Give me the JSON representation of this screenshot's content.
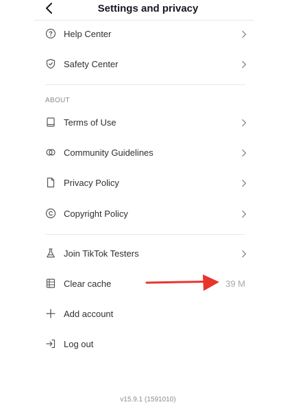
{
  "header": {
    "title": "Settings and privacy"
  },
  "support": {
    "items": [
      {
        "label": "Help Center",
        "icon": "question-circle-icon"
      },
      {
        "label": "Safety Center",
        "icon": "shield-check-icon"
      }
    ]
  },
  "about": {
    "section_label": "ABOUT",
    "items": [
      {
        "label": "Terms of Use",
        "icon": "book-icon"
      },
      {
        "label": "Community Guidelines",
        "icon": "interlocking-circles-icon"
      },
      {
        "label": "Privacy Policy",
        "icon": "document-icon"
      },
      {
        "label": "Copyright Policy",
        "icon": "copyright-icon"
      }
    ]
  },
  "other": {
    "items": [
      {
        "label": "Join TikTok Testers",
        "icon": "flask-icon"
      },
      {
        "label": "Clear cache",
        "icon": "cache-icon",
        "value": "39 M"
      },
      {
        "label": "Add account",
        "icon": "plus-icon"
      },
      {
        "label": "Log out",
        "icon": "logout-icon"
      }
    ]
  },
  "annotation": {
    "arrow_color": "#e8352c"
  },
  "footer": {
    "version": "v15.9.1 (1591010)"
  }
}
